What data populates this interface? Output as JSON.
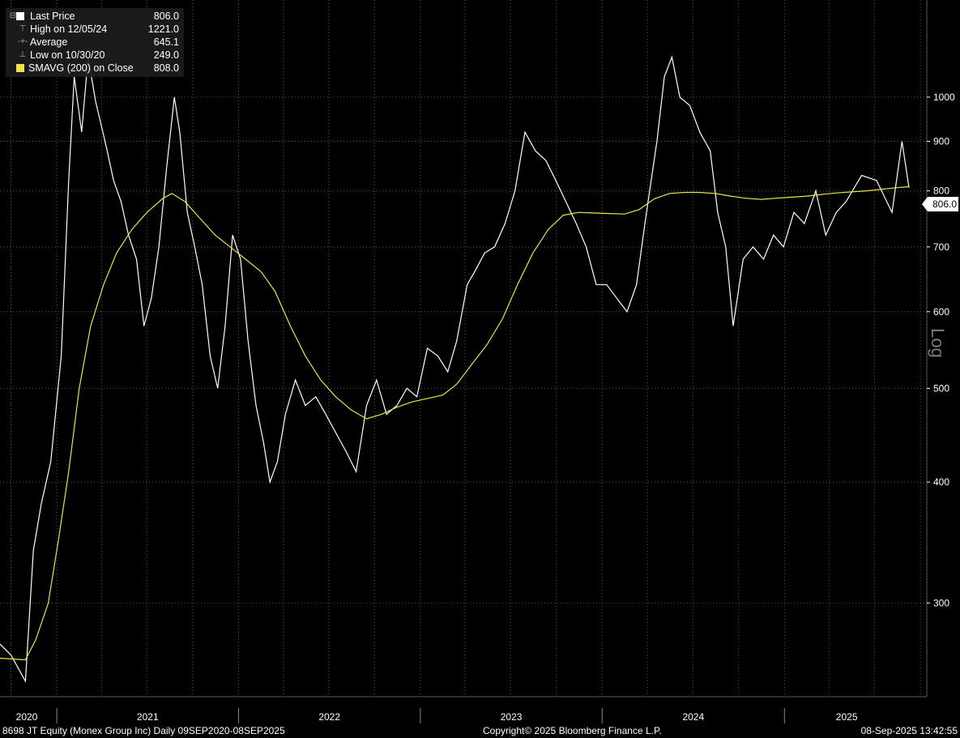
{
  "legend": {
    "last_price_label": "Last Price",
    "last_price_value": "806.0",
    "high_label": "High on 12/05/24",
    "high_value": "1221.0",
    "average_label": "Average",
    "average_value": "645.1",
    "low_label": "Low on 10/30/20",
    "low_value": "249.0",
    "smavg_label": "SMAVG (200)  on Close",
    "smavg_value": "808.0",
    "high_symbol": "⊤",
    "average_symbol": "-+-",
    "low_symbol": "⊥",
    "collapse_symbol": "⊟"
  },
  "axis": {
    "scale_label": "Log",
    "last_tag": "806.0"
  },
  "footer": {
    "left": "8698 JT Equity (Monex Group Inc)  Daily 09SEP2020-08SEP2025",
    "center": "Copyright© 2025 Bloomberg Finance L.P.",
    "right": "08-Sep-2025 13:42:55"
  },
  "colors": {
    "background": "#000000",
    "price": "#ffffff",
    "smavg": "#f0e24a",
    "grid": "#5a5a5a"
  },
  "chart_data": {
    "type": "line",
    "y_scale": "log",
    "ylim": [
      240,
      1260
    ],
    "y_ticks": [
      300,
      400,
      500,
      600,
      700,
      800,
      900,
      1000
    ],
    "x_range": [
      "2020-09-09",
      "2025-09-08"
    ],
    "x_tick_labels": [
      "2020",
      "2021",
      "2022",
      "2023",
      "2024",
      "2025"
    ],
    "grid": true,
    "series": [
      {
        "name": "Last Price",
        "points": [
          [
            "2020-09-09",
            272
          ],
          [
            "2020-10-01",
            265
          ],
          [
            "2020-10-30",
            249
          ],
          [
            "2020-11-15",
            340
          ],
          [
            "2020-12-01",
            380
          ],
          [
            "2020-12-20",
            420
          ],
          [
            "2021-01-10",
            540
          ],
          [
            "2021-01-25",
            820
          ],
          [
            "2021-02-05",
            1050
          ],
          [
            "2021-02-20",
            920
          ],
          [
            "2021-03-05",
            1100
          ],
          [
            "2021-03-20",
            990
          ],
          [
            "2021-04-10",
            890
          ],
          [
            "2021-04-25",
            820
          ],
          [
            "2021-05-10",
            780
          ],
          [
            "2021-05-25",
            720
          ],
          [
            "2021-06-10",
            680
          ],
          [
            "2021-06-25",
            580
          ],
          [
            "2021-07-10",
            620
          ],
          [
            "2021-07-25",
            700
          ],
          [
            "2021-08-10",
            850
          ],
          [
            "2021-08-25",
            1000
          ],
          [
            "2021-09-05",
            920
          ],
          [
            "2021-09-20",
            760
          ],
          [
            "2021-10-05",
            700
          ],
          [
            "2021-10-20",
            640
          ],
          [
            "2021-11-05",
            540
          ],
          [
            "2021-11-20",
            500
          ],
          [
            "2021-12-05",
            580
          ],
          [
            "2021-12-20",
            720
          ],
          [
            "2022-01-05",
            680
          ],
          [
            "2022-01-20",
            560
          ],
          [
            "2022-02-05",
            480
          ],
          [
            "2022-02-20",
            440
          ],
          [
            "2022-03-05",
            400
          ],
          [
            "2022-03-20",
            420
          ],
          [
            "2022-04-05",
            470
          ],
          [
            "2022-04-25",
            510
          ],
          [
            "2022-05-15",
            480
          ],
          [
            "2022-06-05",
            490
          ],
          [
            "2022-06-25",
            470
          ],
          [
            "2022-07-15",
            450
          ],
          [
            "2022-08-05",
            430
          ],
          [
            "2022-08-25",
            410
          ],
          [
            "2022-09-15",
            480
          ],
          [
            "2022-10-05",
            510
          ],
          [
            "2022-10-25",
            470
          ],
          [
            "2022-11-15",
            480
          ],
          [
            "2022-12-05",
            500
          ],
          [
            "2022-12-25",
            490
          ],
          [
            "2023-01-15",
            550
          ],
          [
            "2023-02-05",
            540
          ],
          [
            "2023-02-25",
            520
          ],
          [
            "2023-03-15",
            560
          ],
          [
            "2023-04-05",
            640
          ],
          [
            "2023-04-20",
            660
          ],
          [
            "2023-05-10",
            690
          ],
          [
            "2023-05-30",
            700
          ],
          [
            "2023-06-20",
            740
          ],
          [
            "2023-07-10",
            800
          ],
          [
            "2023-07-30",
            920
          ],
          [
            "2023-08-20",
            880
          ],
          [
            "2023-09-10",
            860
          ],
          [
            "2023-09-30",
            820
          ],
          [
            "2023-10-20",
            780
          ],
          [
            "2023-11-10",
            740
          ],
          [
            "2023-11-30",
            700
          ],
          [
            "2023-12-20",
            640
          ],
          [
            "2024-01-10",
            640
          ],
          [
            "2024-01-30",
            620
          ],
          [
            "2024-02-20",
            600
          ],
          [
            "2024-03-10",
            640
          ],
          [
            "2024-03-30",
            760
          ],
          [
            "2024-04-20",
            900
          ],
          [
            "2024-05-05",
            1050
          ],
          [
            "2024-05-20",
            1100
          ],
          [
            "2024-06-05",
            1000
          ],
          [
            "2024-06-25",
            980
          ],
          [
            "2024-07-15",
            920
          ],
          [
            "2024-08-05",
            880
          ],
          [
            "2024-08-20",
            760
          ],
          [
            "2024-09-05",
            700
          ],
          [
            "2024-09-20",
            580
          ],
          [
            "2024-10-10",
            680
          ],
          [
            "2024-10-30",
            700
          ],
          [
            "2024-11-20",
            680
          ],
          [
            "2024-12-10",
            720
          ],
          [
            "2024-12-30",
            700
          ],
          [
            "2025-01-20",
            760
          ],
          [
            "2025-02-10",
            740
          ],
          [
            "2025-03-05",
            800
          ],
          [
            "2025-03-25",
            720
          ],
          [
            "2025-04-15",
            760
          ],
          [
            "2025-05-05",
            780
          ],
          [
            "2025-06-05",
            830
          ],
          [
            "2025-07-05",
            820
          ],
          [
            "2025-08-05",
            760
          ],
          [
            "2025-08-25",
            900
          ],
          [
            "2025-09-08",
            806
          ]
        ]
      },
      {
        "name": "SMAVG (200)  on Close",
        "points": [
          [
            "2020-09-09",
            263
          ],
          [
            "2020-10-30",
            262
          ],
          [
            "2020-11-20",
            275
          ],
          [
            "2020-12-15",
            300
          ],
          [
            "2021-01-05",
            350
          ],
          [
            "2021-01-25",
            410
          ],
          [
            "2021-02-15",
            500
          ],
          [
            "2021-03-10",
            580
          ],
          [
            "2021-04-05",
            640
          ],
          [
            "2021-05-01",
            690
          ],
          [
            "2021-06-01",
            730
          ],
          [
            "2021-07-01",
            760
          ],
          [
            "2021-08-01",
            785
          ],
          [
            "2021-08-20",
            795
          ],
          [
            "2021-09-15",
            780
          ],
          [
            "2021-10-15",
            750
          ],
          [
            "2021-11-15",
            720
          ],
          [
            "2021-12-15",
            700
          ],
          [
            "2022-01-15",
            680
          ],
          [
            "2022-02-15",
            660
          ],
          [
            "2022-03-15",
            630
          ],
          [
            "2022-04-15",
            580
          ],
          [
            "2022-05-15",
            540
          ],
          [
            "2022-06-15",
            510
          ],
          [
            "2022-07-15",
            490
          ],
          [
            "2022-08-15",
            475
          ],
          [
            "2022-09-15",
            465
          ],
          [
            "2022-10-15",
            470
          ],
          [
            "2022-11-15",
            478
          ],
          [
            "2022-12-15",
            484
          ],
          [
            "2023-01-15",
            488
          ],
          [
            "2023-02-15",
            492
          ],
          [
            "2023-03-15",
            505
          ],
          [
            "2023-04-15",
            530
          ],
          [
            "2023-05-15",
            555
          ],
          [
            "2023-06-15",
            590
          ],
          [
            "2023-07-15",
            640
          ],
          [
            "2023-08-15",
            690
          ],
          [
            "2023-09-15",
            730
          ],
          [
            "2023-10-15",
            755
          ],
          [
            "2023-11-15",
            760
          ],
          [
            "2023-12-15",
            759
          ],
          [
            "2024-01-15",
            758
          ],
          [
            "2024-02-15",
            757
          ],
          [
            "2024-03-15",
            765
          ],
          [
            "2024-04-15",
            785
          ],
          [
            "2024-05-15",
            795
          ],
          [
            "2024-06-15",
            797
          ],
          [
            "2024-07-15",
            797
          ],
          [
            "2024-08-15",
            795
          ],
          [
            "2024-09-15",
            790
          ],
          [
            "2024-10-15",
            786
          ],
          [
            "2024-11-15",
            784
          ],
          [
            "2024-12-15",
            786
          ],
          [
            "2025-01-15",
            788
          ],
          [
            "2025-02-15",
            790
          ],
          [
            "2025-03-15",
            793
          ],
          [
            "2025-04-15",
            796
          ],
          [
            "2025-05-15",
            798
          ],
          [
            "2025-06-15",
            800
          ],
          [
            "2025-07-15",
            803
          ],
          [
            "2025-08-15",
            806
          ],
          [
            "2025-09-08",
            808
          ]
        ]
      }
    ]
  }
}
